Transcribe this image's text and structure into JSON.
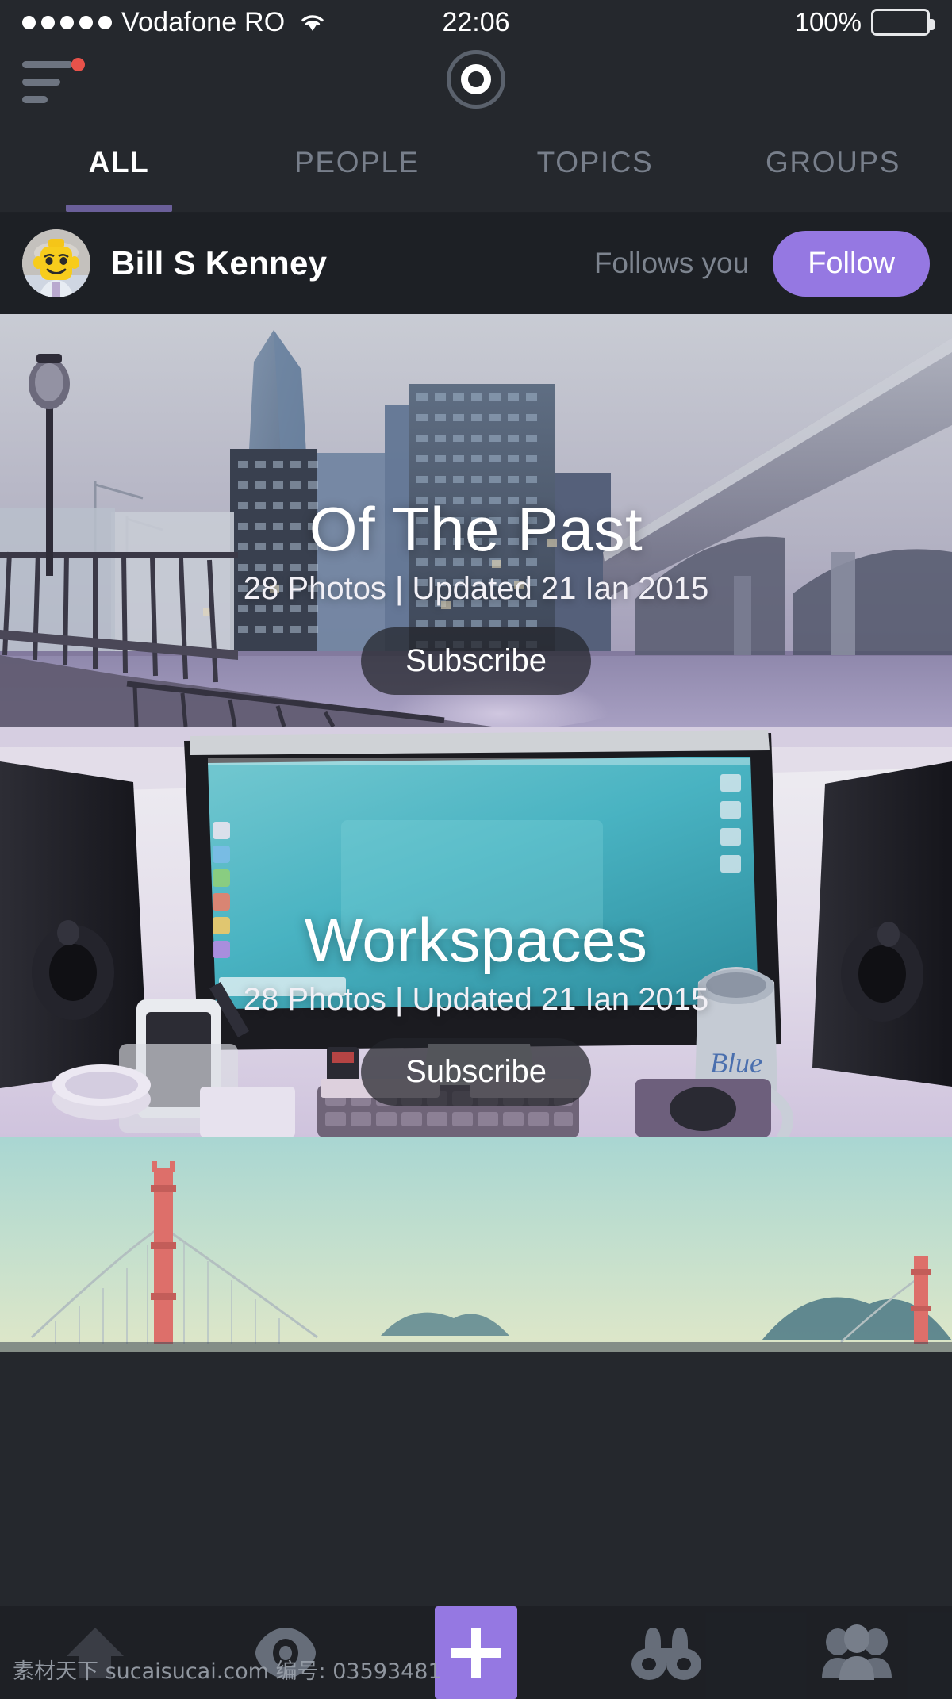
{
  "status_bar": {
    "signal_dots": 5,
    "carrier": "Vodafone RO",
    "wifi_icon": "wifi-icon",
    "time": "22:06",
    "battery_pct": "100%",
    "battery_icon": "battery-full-icon"
  },
  "header": {
    "menu_icon": "hamburger-menu-icon",
    "has_notification": true,
    "logo_icon": "app-logo-circle-icon"
  },
  "tabs": [
    {
      "label": "ALL",
      "active": true
    },
    {
      "label": "PEOPLE",
      "active": false
    },
    {
      "label": "TOPICS",
      "active": false
    },
    {
      "label": "GROUPS",
      "active": false
    }
  ],
  "user_row": {
    "avatar_icon": "lego-avatar",
    "name": "Bill S Kenney",
    "relation": "Follows you",
    "follow_label": "Follow"
  },
  "cards": [
    {
      "title": "Of The Past",
      "meta": "28 Photos | Updated 21 Ian 2015",
      "action_label": "Subscribe",
      "image_alt": "london-cityscape-bridge-photo"
    },
    {
      "title": "Workspaces",
      "meta": "28 Photos | Updated 21 Ian 2015",
      "action_label": "Subscribe",
      "image_alt": "desk-workspace-imac-photo"
    },
    {
      "title": "",
      "meta": "",
      "action_label": "",
      "image_alt": "golden-gate-bridge-illustration"
    }
  ],
  "bottom_nav": [
    {
      "icon": "home-icon",
      "label": "Home",
      "active": false
    },
    {
      "icon": "eye-icon",
      "label": "Watching",
      "active": false
    },
    {
      "icon": "plus-icon",
      "label": "Add",
      "active": true
    },
    {
      "icon": "binoculars-icon",
      "label": "Discover",
      "active": false
    },
    {
      "icon": "people-icon",
      "label": "People",
      "active": false
    }
  ],
  "watermark": "素材天下 sucaisucai.com 编号: 03593481",
  "colors": {
    "accent_purple": "#9578e2",
    "tab_underline": "#6a5f99",
    "bg_dark": "#25282d",
    "row_dark": "#1d2025",
    "notification_red": "#e8524a",
    "muted_text": "#787f8b"
  }
}
